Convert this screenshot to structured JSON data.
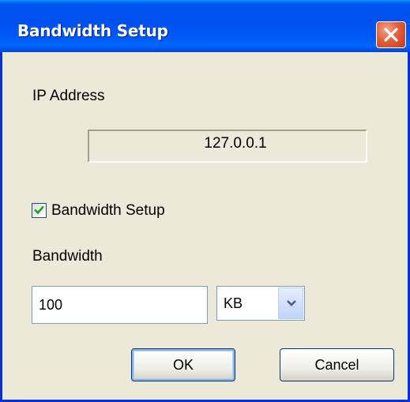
{
  "window": {
    "title": "Bandwidth Setup",
    "close_icon": "close-icon"
  },
  "ip": {
    "label": "IP Address",
    "value": "127.0.0.1"
  },
  "bandwidth_setup": {
    "label": "Bandwidth Setup",
    "checked": true
  },
  "bandwidth": {
    "label": "Bandwidth",
    "value": "100",
    "unit_selected": "KB"
  },
  "buttons": {
    "ok_label": "OK",
    "cancel_label": "Cancel"
  },
  "colors": {
    "titlebar": "#0053EE",
    "dialog_bg": "#ECE9D8",
    "close_button": "#E2603B",
    "checkmark": "#21A121"
  }
}
